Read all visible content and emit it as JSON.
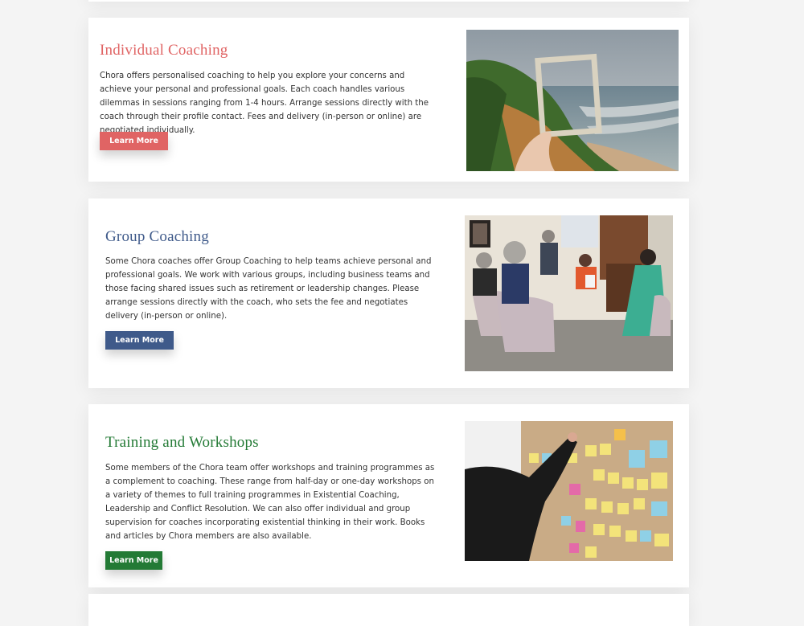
{
  "colors": {
    "individual_accent": "#e06464",
    "group_accent": "#3f5a8a",
    "training_accent": "#237a35",
    "body_text": "#333333",
    "page_bg": "#f4f4f4"
  },
  "sections": [
    {
      "title": "Individual Coaching",
      "body": "Chora offers personalised coaching to help you explore your concerns and achieve your personal and professional goals. Each coach handles various dilemmas in sessions ranging from 1-4 hours. Arrange sessions directly with the coach through their profile contact. Fees and delivery (in-person or online) are negotiated individually.",
      "button_label": "Learn More"
    },
    {
      "title": "Group Coaching",
      "body": "Some Chora coaches offer Group Coaching to help teams achieve personal and professional goals. We work with various groups, including business teams and those facing shared issues such as retirement or leadership changes. Please arrange sessions directly with the coach, who sets the fee and negotiates delivery (in-person or online).",
      "button_label": "Learn More"
    },
    {
      "title": "Training and Workshops",
      "body": "Some members of the Chora team offer workshops and training programmes as a complement to coaching. These range from half-day or one-day workshops on a variety of themes to full training programmes in Existential Coaching, Leadership and Conflict Resolution. We can also offer individual and group supervision for coaches incorporating existential thinking in their work. Books and articles by Chora members are also available.",
      "button_label": "Learn More"
    }
  ]
}
